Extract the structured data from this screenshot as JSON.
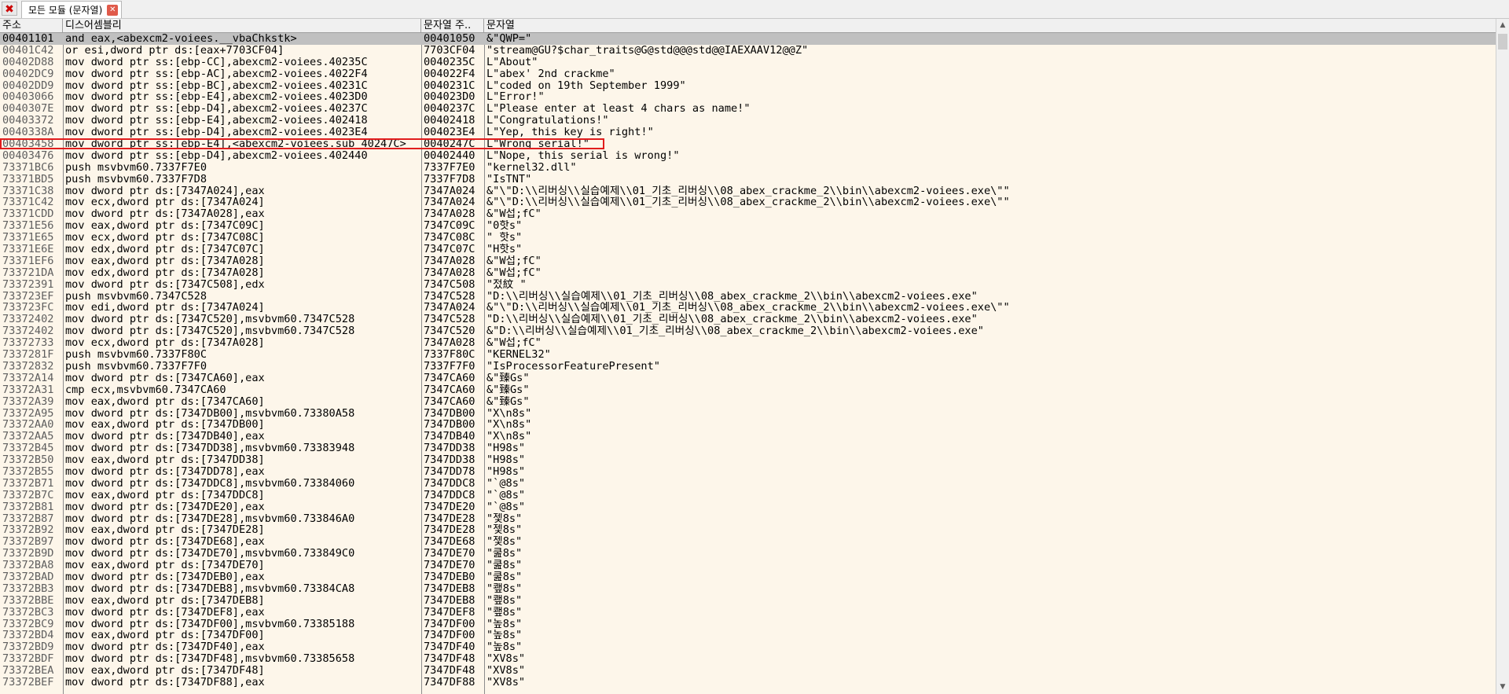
{
  "toolbar": {
    "close_icon": "✖"
  },
  "tab": {
    "label": "모든 모듈 (문자열)",
    "close_icon": "✕"
  },
  "columns": {
    "address": "주소",
    "disassembly": "디스어셈블리",
    "string_address": "문자열 주..",
    "string": "문자열"
  },
  "scrollbar": {
    "up_icon": "▲",
    "down_icon": "▼"
  },
  "rows": [
    {
      "addr": "00401101",
      "dis": "and eax,<abexcm2-voiees.__vbaChkstk>",
      "saddr": "00401050",
      "str": "&\"QWP=\"",
      "selected": true
    },
    {
      "addr": "00401C42",
      "dis": "or esi,dword ptr ds:[eax+7703CF04]",
      "saddr": "7703CF04",
      "str": "\"stream@GU?$char_traits@G@std@@@std@@IAEXAAV12@@Z\""
    },
    {
      "addr": "00402D88",
      "dis": "mov dword ptr ss:[ebp-CC],abexcm2-voiees.40235C",
      "saddr": "0040235C",
      "str": "L\"About\""
    },
    {
      "addr": "00402DC9",
      "dis": "mov dword ptr ss:[ebp-AC],abexcm2-voiees.4022F4",
      "saddr": "004022F4",
      "str": "L\"abex' 2nd crackme\""
    },
    {
      "addr": "00402DD9",
      "dis": "mov dword ptr ss:[ebp-BC],abexcm2-voiees.40231C",
      "saddr": "0040231C",
      "str": "L\"coded on 19th September 1999\""
    },
    {
      "addr": "00403066",
      "dis": "mov dword ptr ss:[ebp-E4],abexcm2-voiees.4023D0",
      "saddr": "004023D0",
      "str": "L\"Error!\""
    },
    {
      "addr": "0040307E",
      "dis": "mov dword ptr ss:[ebp-D4],abexcm2-voiees.40237C",
      "saddr": "0040237C",
      "str": "L\"Please enter at least 4 chars as name!\""
    },
    {
      "addr": "00403372",
      "dis": "mov dword ptr ss:[ebp-E4],abexcm2-voiees.402418",
      "saddr": "00402418",
      "str": "L\"Congratulations!\""
    },
    {
      "addr": "0040338A",
      "dis": "mov dword ptr ss:[ebp-D4],abexcm2-voiees.4023E4",
      "saddr": "004023E4",
      "str": "L\"Yep, this key is right!\""
    },
    {
      "addr": "00403458",
      "dis": "mov dword ptr ss:[ebp-E4],<abexcm2-voiees.sub_40247C>",
      "saddr": "0040247C",
      "str": "L\"Wrong serial!\"",
      "highlight": true
    },
    {
      "addr": "00403476",
      "dis": "mov dword ptr ss:[ebp-D4],abexcm2-voiees.402440",
      "saddr": "00402440",
      "str": "L\"Nope, this serial is wrong!\""
    },
    {
      "addr": "73371BC6",
      "dis": "push msvbvm60.7337F7E0",
      "saddr": "7337F7E0",
      "str": "\"kernel32.dll\""
    },
    {
      "addr": "73371BD5",
      "dis": "push msvbvm60.7337F7D8",
      "saddr": "7337F7D8",
      "str": "\"IsTNT\""
    },
    {
      "addr": "73371C38",
      "dis": "mov dword ptr ds:[7347A024],eax",
      "saddr": "7347A024",
      "str": "&\"\\\"D:\\\\리버싱\\\\실습예제\\\\01_기초_리버싱\\\\08_abex_crackme_2\\\\bin\\\\abexcm2-voiees.exe\\\"\""
    },
    {
      "addr": "73371C42",
      "dis": "mov ecx,dword ptr ds:[7347A024]",
      "saddr": "7347A024",
      "str": "&\"\\\"D:\\\\리버싱\\\\실습예제\\\\01_기초_리버싱\\\\08_abex_crackme_2\\\\bin\\\\abexcm2-voiees.exe\\\"\""
    },
    {
      "addr": "73371CDD",
      "dis": "mov dword ptr ds:[7347A028],eax",
      "saddr": "7347A028",
      "str": "&\"W섭;fC\""
    },
    {
      "addr": "73371E56",
      "dis": "mov eax,dword ptr ds:[7347C09C]",
      "saddr": "7347C09C",
      "str": "\"0핫s\""
    },
    {
      "addr": "73371E65",
      "dis": "mov ecx,dword ptr ds:[7347C08C]",
      "saddr": "7347C08C",
      "str": "\" 핫s\""
    },
    {
      "addr": "73371E6E",
      "dis": "mov edx,dword ptr ds:[7347C07C]",
      "saddr": "7347C07C",
      "str": "\"H핫s\""
    },
    {
      "addr": "73371EF6",
      "dis": "mov eax,dword ptr ds:[7347A028]",
      "saddr": "7347A028",
      "str": "&\"W섭;fC\""
    },
    {
      "addr": "733721DA",
      "dis": "mov edx,dword ptr ds:[7347A028]",
      "saddr": "7347A028",
      "str": "&\"W섭;fC\""
    },
    {
      "addr": "73372391",
      "dis": "mov dword ptr ds:[7347C508],edx",
      "saddr": "7347C508",
      "str": "\"젔紋 \""
    },
    {
      "addr": "733723EF",
      "dis": "push msvbvm60.7347C528",
      "saddr": "7347C528",
      "str": "\"D:\\\\리버싱\\\\실습예제\\\\01_기초_리버싱\\\\08_abex_crackme_2\\\\bin\\\\abexcm2-voiees.exe\""
    },
    {
      "addr": "733723FC",
      "dis": "mov edi,dword ptr ds:[7347A024]",
      "saddr": "7347A024",
      "str": "&\"\\\"D:\\\\리버싱\\\\실습예제\\\\01_기초_리버싱\\\\08_abex_crackme_2\\\\bin\\\\abexcm2-voiees.exe\\\"\""
    },
    {
      "addr": "73372402",
      "dis": "mov dword ptr ds:[7347C520],msvbvm60.7347C528",
      "saddr": "7347C528",
      "str": "\"D:\\\\리버싱\\\\실습예제\\\\01_기초_리버싱\\\\08_abex_crackme_2\\\\bin\\\\abexcm2-voiees.exe\""
    },
    {
      "addr": "73372402",
      "dis": "mov dword ptr ds:[7347C520],msvbvm60.7347C528",
      "saddr": "7347C520",
      "str": "&\"D:\\\\리버싱\\\\실습예제\\\\01_기초_리버싱\\\\08_abex_crackme_2\\\\bin\\\\abexcm2-voiees.exe\""
    },
    {
      "addr": "73372733",
      "dis": "mov ecx,dword ptr ds:[7347A028]",
      "saddr": "7347A028",
      "str": "&\"W섭;fC\""
    },
    {
      "addr": "7337281F",
      "dis": "push msvbvm60.7337F80C",
      "saddr": "7337F80C",
      "str": "\"KERNEL32\""
    },
    {
      "addr": "73372832",
      "dis": "push msvbvm60.7337F7F0",
      "saddr": "7337F7F0",
      "str": "\"IsProcessorFeaturePresent\""
    },
    {
      "addr": "73372A14",
      "dis": "mov dword ptr ds:[7347CA60],eax",
      "saddr": "7347CA60",
      "str": "&\"臻Gs\""
    },
    {
      "addr": "73372A31",
      "dis": "cmp ecx,msvbvm60.7347CA60",
      "saddr": "7347CA60",
      "str": "&\"臻Gs\""
    },
    {
      "addr": "73372A39",
      "dis": "mov eax,dword ptr ds:[7347CA60]",
      "saddr": "7347CA60",
      "str": "&\"臻Gs\""
    },
    {
      "addr": "73372A95",
      "dis": "mov dword ptr ds:[7347DB00],msvbvm60.73380A58",
      "saddr": "7347DB00",
      "str": "\"X\\n8s\""
    },
    {
      "addr": "73372AA0",
      "dis": "mov eax,dword ptr ds:[7347DB00]",
      "saddr": "7347DB00",
      "str": "\"X\\n8s\""
    },
    {
      "addr": "73372AA5",
      "dis": "mov dword ptr ds:[7347DB40],eax",
      "saddr": "7347DB40",
      "str": "\"X\\n8s\""
    },
    {
      "addr": "73372B45",
      "dis": "mov dword ptr ds:[7347DD38],msvbvm60.73383948",
      "saddr": "7347DD38",
      "str": "\"H98s\""
    },
    {
      "addr": "73372B50",
      "dis": "mov eax,dword ptr ds:[7347DD38]",
      "saddr": "7347DD38",
      "str": "\"H98s\""
    },
    {
      "addr": "73372B55",
      "dis": "mov dword ptr ds:[7347DD78],eax",
      "saddr": "7347DD78",
      "str": "\"H98s\""
    },
    {
      "addr": "73372B71",
      "dis": "mov dword ptr ds:[7347DDC8],msvbvm60.73384060",
      "saddr": "7347DDC8",
      "str": "\"`@8s\""
    },
    {
      "addr": "73372B7C",
      "dis": "mov eax,dword ptr ds:[7347DDC8]",
      "saddr": "7347DDC8",
      "str": "\"`@8s\""
    },
    {
      "addr": "73372B81",
      "dis": "mov dword ptr ds:[7347DE20],eax",
      "saddr": "7347DE20",
      "str": "\"`@8s\""
    },
    {
      "addr": "73372B87",
      "dis": "mov dword ptr ds:[7347DE28],msvbvm60.733846A0",
      "saddr": "7347DE28",
      "str": "\"젳8s\""
    },
    {
      "addr": "73372B92",
      "dis": "mov eax,dword ptr ds:[7347DE28]",
      "saddr": "7347DE28",
      "str": "\"젳8s\""
    },
    {
      "addr": "73372B97",
      "dis": "mov dword ptr ds:[7347DE68],eax",
      "saddr": "7347DE68",
      "str": "\"젳8s\""
    },
    {
      "addr": "73372B9D",
      "dis": "mov dword ptr ds:[7347DE70],msvbvm60.733849C0",
      "saddr": "7347DE70",
      "str": "\"쿮8s\""
    },
    {
      "addr": "73372BA8",
      "dis": "mov eax,dword ptr ds:[7347DE70]",
      "saddr": "7347DE70",
      "str": "\"쿮8s\""
    },
    {
      "addr": "73372BAD",
      "dis": "mov dword ptr ds:[7347DEB0],eax",
      "saddr": "7347DEB0",
      "str": "\"쿮8s\""
    },
    {
      "addr": "73372BB3",
      "dis": "mov dword ptr ds:[7347DEB8],msvbvm60.73384CA8",
      "saddr": "7347DEB8",
      "str": "\"쾦8s\""
    },
    {
      "addr": "73372BBE",
      "dis": "mov eax,dword ptr ds:[7347DEB8]",
      "saddr": "7347DEB8",
      "str": "\"쾦8s\""
    },
    {
      "addr": "73372BC3",
      "dis": "mov dword ptr ds:[7347DEF8],eax",
      "saddr": "7347DEF8",
      "str": "\"쾦8s\""
    },
    {
      "addr": "73372BC9",
      "dis": "mov dword ptr ds:[7347DF00],msvbvm60.73385188",
      "saddr": "7347DF00",
      "str": "\"높8s\""
    },
    {
      "addr": "73372BD4",
      "dis": "mov eax,dword ptr ds:[7347DF00]",
      "saddr": "7347DF00",
      "str": "\"높8s\""
    },
    {
      "addr": "73372BD9",
      "dis": "mov dword ptr ds:[7347DF40],eax",
      "saddr": "7347DF40",
      "str": "\"높8s\""
    },
    {
      "addr": "73372BDF",
      "dis": "mov dword ptr ds:[7347DF48],msvbvm60.73385658",
      "saddr": "7347DF48",
      "str": "\"XV8s\""
    },
    {
      "addr": "73372BEA",
      "dis": "mov eax,dword ptr ds:[7347DF48]",
      "saddr": "7347DF48",
      "str": "\"XV8s\""
    },
    {
      "addr": "73372BEF",
      "dis": "mov dword ptr ds:[7347DF88],eax",
      "saddr": "7347DF88",
      "str": "\"XV8s\""
    }
  ],
  "colors": {
    "background": "#fdf6ea",
    "selected_row": "#c0c0c0",
    "highlight_border": "#e11d1d"
  }
}
